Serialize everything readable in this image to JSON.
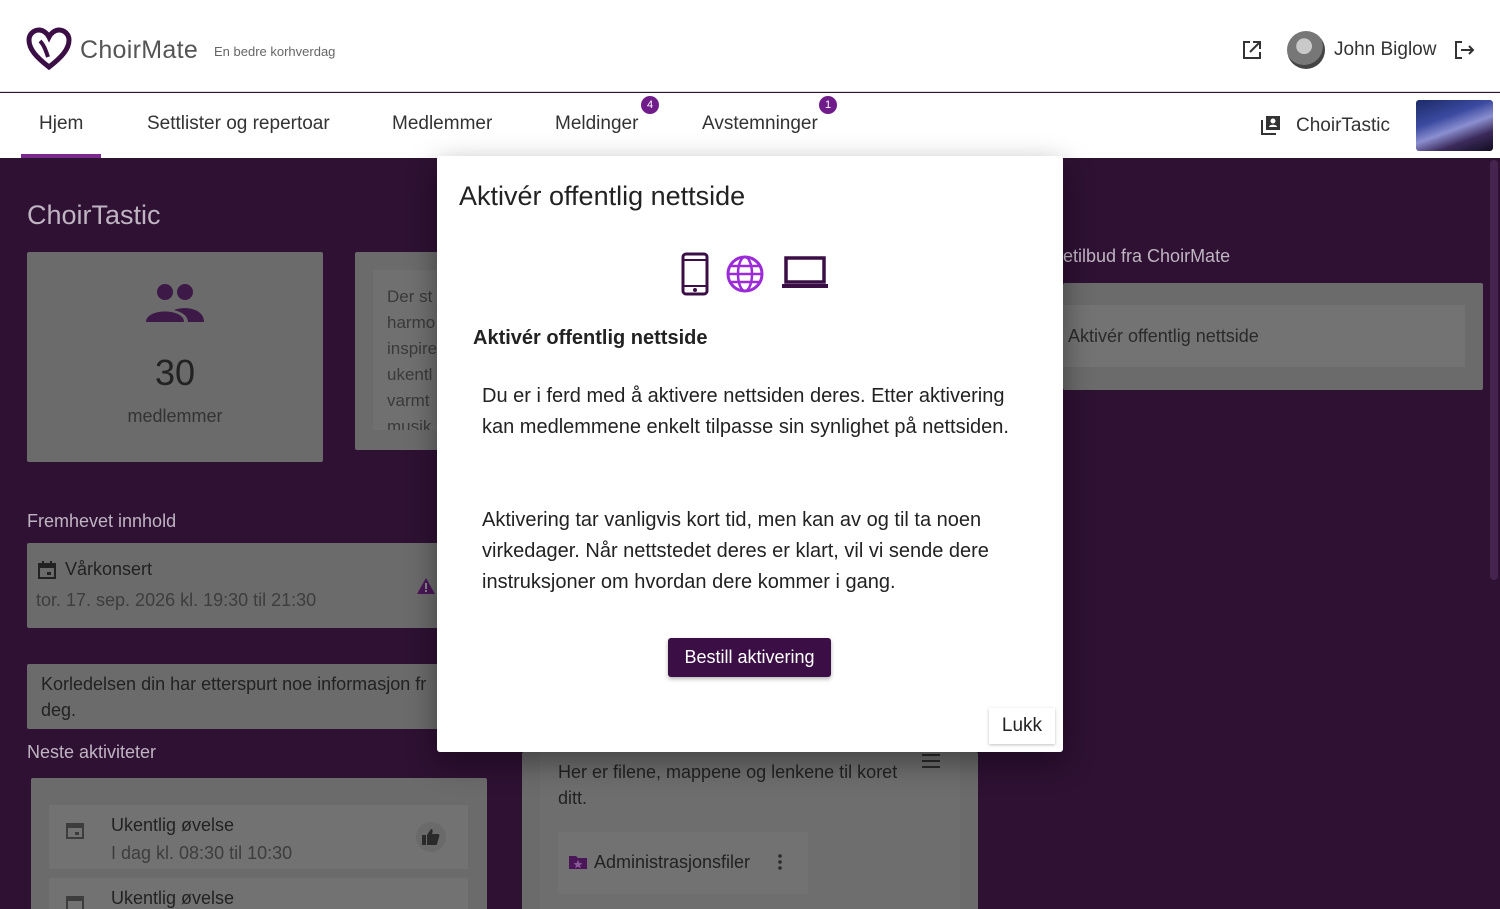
{
  "header": {
    "logo_text": "ChoirMate",
    "tagline": "En bedre korhverdag",
    "user_name": "John Biglow"
  },
  "nav": {
    "items": [
      {
        "label": "Hjem"
      },
      {
        "label": "Settlister og repertoar"
      },
      {
        "label": "Medlemmer"
      },
      {
        "label": "Meldinger",
        "badge": "4"
      },
      {
        "label": "Avstemninger",
        "badge": "1"
      }
    ],
    "active": "Hjem",
    "choir_name": "ChoirTastic"
  },
  "dashboard": {
    "title": "ChoirTastic",
    "members_count": "30",
    "members_label": "medlemmer",
    "description_lines": [
      "Der st",
      "harmo",
      "inspire",
      "ukentl",
      "varmt",
      "musik"
    ],
    "offers_heading": "etilbud fra ChoirMate",
    "offer_item": "Aktivér offentlig nettside",
    "featured_heading": "Fremhevet innhold",
    "featured_event": {
      "title": "Vårkonsert",
      "time": "tor. 17. sep. 2026 kl. 19:30 til 21:30"
    },
    "info_notice": "Korledelsen din har etterspurt noe informasjon fr",
    "info_notice_cont": "deg.",
    "next_heading": "Neste aktiviteter",
    "activities": [
      {
        "title": "Ukentlig øvelse",
        "time": "I dag kl. 08:30 til 10:30"
      },
      {
        "title": "Ukentlig øvelse",
        "time": ""
      }
    ],
    "files_text_line1": "Her er filene, mappene og lenkene til koret",
    "files_text_line2": "ditt.",
    "folder_name": "Administrasjonsfiler"
  },
  "modal": {
    "title": "Aktivér offentlig nettside",
    "subtitle": "Aktivér offentlig nettside",
    "para1": "Du er i ferd med å aktivere nettsiden deres. Etter aktivering kan medlemmene enkelt tilpasse sin synlighet på nettsiden.",
    "para2": "Aktivering tar vanligvis kort tid, men kan av og til ta noen virkedager. Når nettstedet deres er klart, vil vi sende dere instruksjoner om hvordan dere kommer i gang.",
    "primary_button": "Bestill aktivering",
    "close_button": "Lukk",
    "icons": [
      "phone-icon",
      "globe-icon",
      "laptop-icon"
    ]
  },
  "colors": {
    "brand_purple": "#3b0f45",
    "accent_purple": "#7a2a8c",
    "background": "#2e1133"
  }
}
